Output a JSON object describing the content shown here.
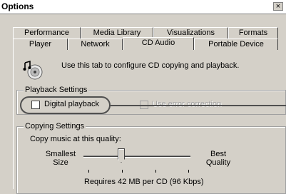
{
  "window": {
    "title": "Options",
    "close_glyph": "×"
  },
  "tabs_row1": [
    {
      "label": "Performance"
    },
    {
      "label": "Media Library"
    },
    {
      "label": "Visualizations"
    },
    {
      "label": "Formats"
    }
  ],
  "tabs_row2": [
    {
      "label": "Player"
    },
    {
      "label": "Network"
    },
    {
      "label": "CD Audio",
      "selected": true
    },
    {
      "label": "Portable Device"
    }
  ],
  "intro": {
    "text": "Use this tab to configure CD copying and playback.",
    "icon": "cd-audio-icon"
  },
  "playback": {
    "legend": "Playback Settings",
    "digital_playback": {
      "label": "Digital playback",
      "checked": false
    },
    "error_correction": {
      "label": "Use error correction",
      "checked": false,
      "enabled": false
    }
  },
  "copying": {
    "legend": "Copying Settings",
    "quality_label": "Copy music at this quality:",
    "left_label_1": "Smallest",
    "left_label_2": "Size",
    "right_label_1": "Best",
    "right_label_2": "Quality",
    "requirement": "Requires 42 MB per CD (96 Kbps)",
    "slider_level": 0.35
  }
}
